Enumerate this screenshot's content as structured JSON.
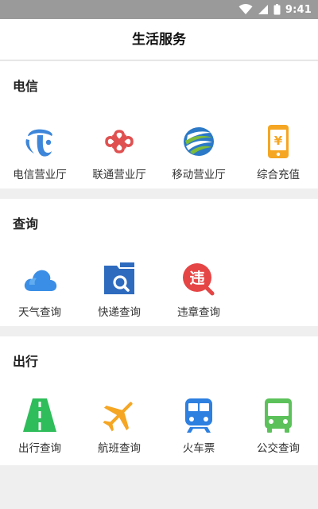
{
  "status_bar": {
    "time": "9:41",
    "wifi_icon": "wifi-icon",
    "signal_icon": "signal-icon",
    "battery_icon": "battery-icon"
  },
  "header": {
    "title": "生活服务"
  },
  "sections": [
    {
      "title": "电信",
      "items": [
        {
          "label": "电信营业厅",
          "icon": "china-telecom-icon"
        },
        {
          "label": "联通营业厅",
          "icon": "china-unicom-icon"
        },
        {
          "label": "移动营业厅",
          "icon": "china-mobile-icon"
        },
        {
          "label": "综合充值",
          "icon": "phone-recharge-icon"
        }
      ]
    },
    {
      "title": "查询",
      "items": [
        {
          "label": "天气查询",
          "icon": "weather-cloud-icon"
        },
        {
          "label": "快递查询",
          "icon": "package-search-icon"
        },
        {
          "label": "违章查询",
          "icon": "violation-search-icon"
        }
      ]
    },
    {
      "title": "出行",
      "items": [
        {
          "label": "出行查询",
          "icon": "road-icon"
        },
        {
          "label": "航班查询",
          "icon": "airplane-icon"
        },
        {
          "label": "火车票",
          "icon": "train-icon"
        },
        {
          "label": "公交查询",
          "icon": "bus-icon"
        }
      ]
    }
  ],
  "colors": {
    "status_bar": "#9a9a9a",
    "page_background": "#efefef",
    "telecom": "#3d86d9",
    "unicom": "#e05050",
    "mobile_blue": "#2b79c7",
    "mobile_green": "#7dbb3a",
    "recharge": "#f5a623",
    "weather": "#3a8ee6",
    "package": "#2e6bbf",
    "violation": "#e64545",
    "road": "#2ebd5a",
    "airplane": "#f5a623",
    "train": "#2d7fe0",
    "bus": "#5cc15a"
  }
}
